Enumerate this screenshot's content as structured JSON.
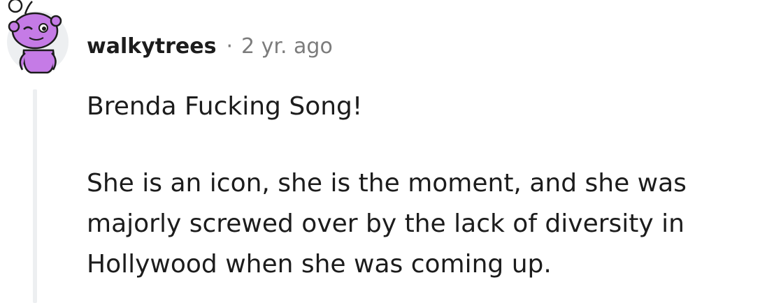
{
  "comment": {
    "author": "walkytrees",
    "separator": "·",
    "age": "2 yr. ago",
    "paragraphs": [
      "Brenda Fucking Song!",
      "She is an icon, she is the moment, and she was majorly screwed over by the lack of diversity in Hollywood when she was coming up."
    ],
    "avatar_icon": "snoo-avatar-icon"
  },
  "colors": {
    "avatar_body": "#c57be6",
    "avatar_circle": "#edeff1",
    "text": "#1c1c1c",
    "meta_text": "#7c7c7c",
    "thread_line": "#edeff1"
  }
}
